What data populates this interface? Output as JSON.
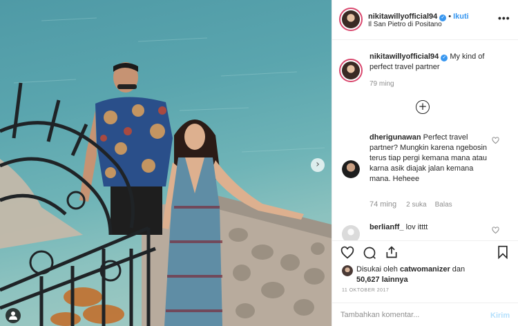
{
  "post": {
    "author": "nikitawillyofficial94",
    "follow_label": "Ikuti",
    "location": "Il San Pietro di Positano",
    "more_icon": "more-horizontal-icon"
  },
  "caption": {
    "author": "nikitawillyofficial94",
    "text": "My kind of perfect travel partner",
    "age": "79 ming"
  },
  "comments": [
    {
      "author": "dherigunawan",
      "text": "Perfect travel partner? Mungkin karena ngebosin terus tiap pergi kemana mana atau karna asik diajak jalan kemana mana. Heheee",
      "age": "74 ming",
      "likes": "2 suka",
      "reply": "Balas"
    },
    {
      "author": "berlianff_",
      "text": "lov itttt"
    }
  ],
  "likes": {
    "prefix": "Disukai oleh",
    "user": "catwomanizer",
    "and": "dan",
    "count": "50,627 lainnya"
  },
  "date": "11 OKTOBER 2017",
  "add_comment": {
    "placeholder": "Tambahkan komentar...",
    "post_label": "Kirim"
  },
  "colors": {
    "accent": "#3897f0",
    "post_disabled": "#b2dffc",
    "muted": "#8e8e8e"
  }
}
